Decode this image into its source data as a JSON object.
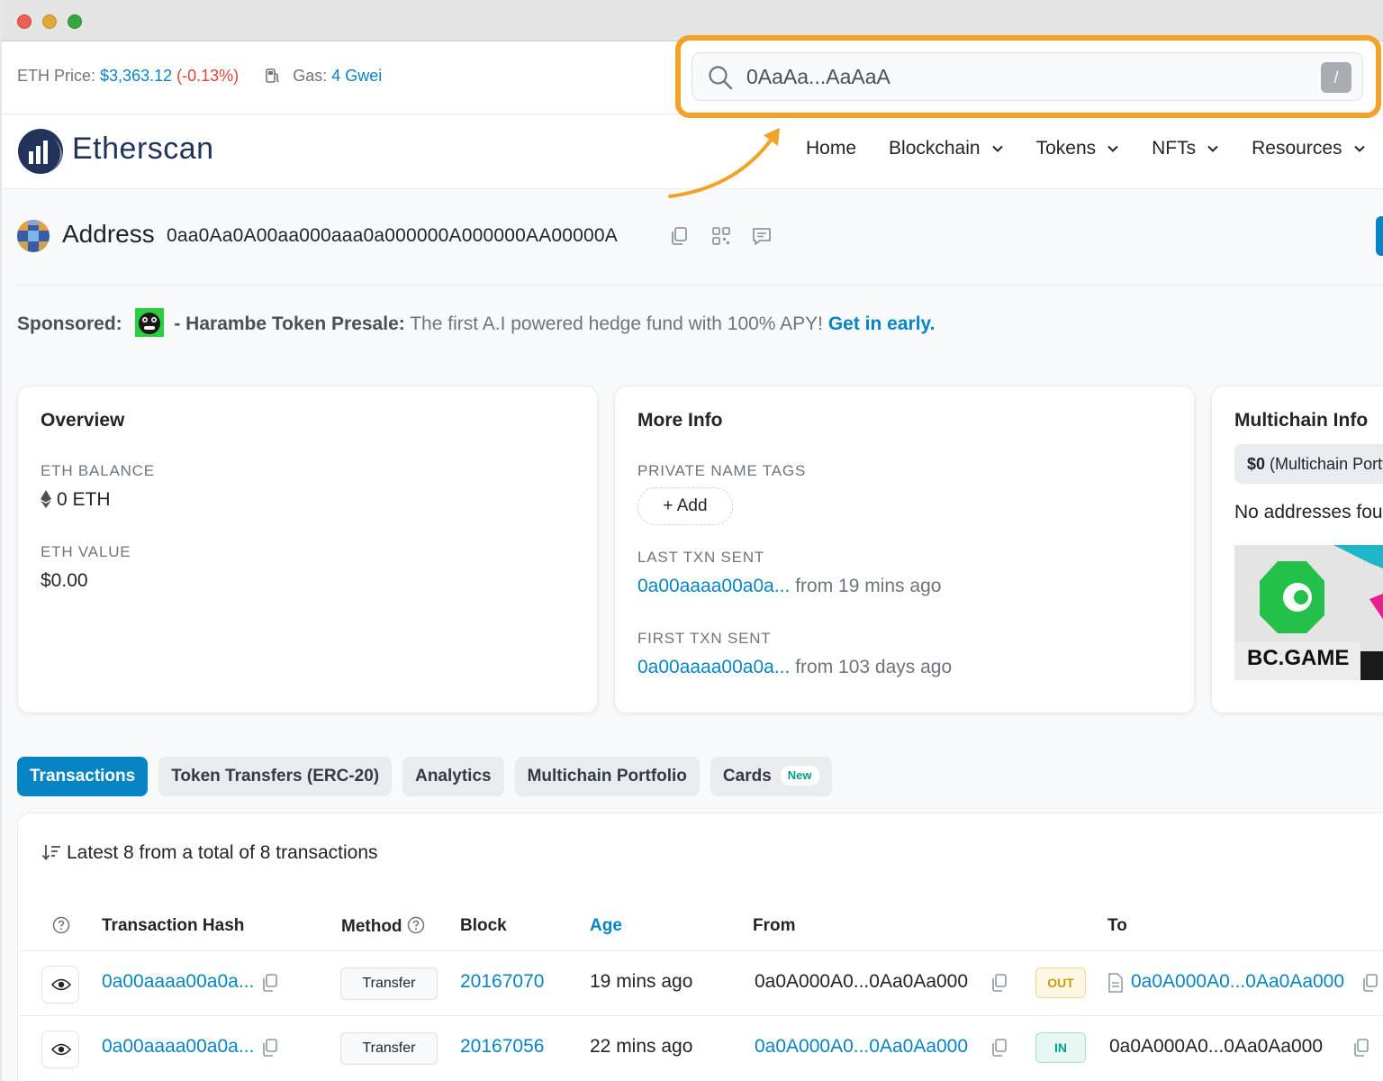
{
  "topbar": {
    "eth_price_label": "ETH Price:",
    "eth_price_value": "$3,363.12",
    "eth_price_change": "(-0.13%)",
    "gas_label": "Gas:",
    "gas_value": "4 Gwei"
  },
  "search": {
    "value": "0AaAa...AaAaA",
    "shortcut": "/"
  },
  "nav": {
    "brand": "Etherscan",
    "items": [
      "Home",
      "Blockchain",
      "Tokens",
      "NFTs",
      "Resources"
    ]
  },
  "address": {
    "label": "Address",
    "value": "0aa0Aa0A00aa000aaa0a000000A000000AA00000A"
  },
  "sponsored": {
    "label": "Sponsored:",
    "title": "- Harambe Token Presale:",
    "text": "The first A.I powered hedge fund with 100% APY!",
    "cta": "Get in early."
  },
  "overview": {
    "title": "Overview",
    "balance_label": "ETH BALANCE",
    "balance_value": "0 ETH",
    "value_label": "ETH VALUE",
    "value_value": "$0.00"
  },
  "more_info": {
    "title": "More Info",
    "tags_label": "PRIVATE NAME TAGS",
    "add_label": "+ Add",
    "last_label": "LAST TXN SENT",
    "last_hash": "0a00aaaa00a0a...",
    "last_time": "from 19 mins ago",
    "first_label": "FIRST TXN SENT",
    "first_hash": "0a00aaaa00a0a...",
    "first_time": "from 103 days ago"
  },
  "multichain": {
    "title": "Multichain Info",
    "pill_amount": "$0",
    "pill_text": "(Multichain Portfolio)",
    "no_addresses": "No addresses found",
    "ad_text": "BC.GAME"
  },
  "tabs": {
    "items": [
      "Transactions",
      "Token Transfers (ERC-20)",
      "Analytics",
      "Multichain Portfolio",
      "Cards"
    ],
    "new_badge": "New"
  },
  "transactions": {
    "summary": "Latest 8 from a total of 8 transactions",
    "headers": {
      "hash": "Transaction Hash",
      "method": "Method",
      "block": "Block",
      "age": "Age",
      "from": "From",
      "to": "To"
    },
    "rows": [
      {
        "hash": "0a00aaaa00a0a...",
        "method": "Transfer",
        "block": "20167070",
        "age": "19 mins ago",
        "from": "0a0A000A0...0Aa0Aa000",
        "direction": "OUT",
        "to": "0a0A000A0...0Aa0Aa000"
      },
      {
        "hash": "0a00aaaa00a0a...",
        "method": "Transfer",
        "block": "20167056",
        "age": "22 mins ago",
        "from": "0a0A000A0...0Aa0Aa000",
        "direction": "IN",
        "to": "0a0A000A0...0Aa0Aa000"
      }
    ]
  },
  "colors": {
    "accent": "#0784c3",
    "highlight": "#f3a127",
    "negative": "#de4437"
  }
}
